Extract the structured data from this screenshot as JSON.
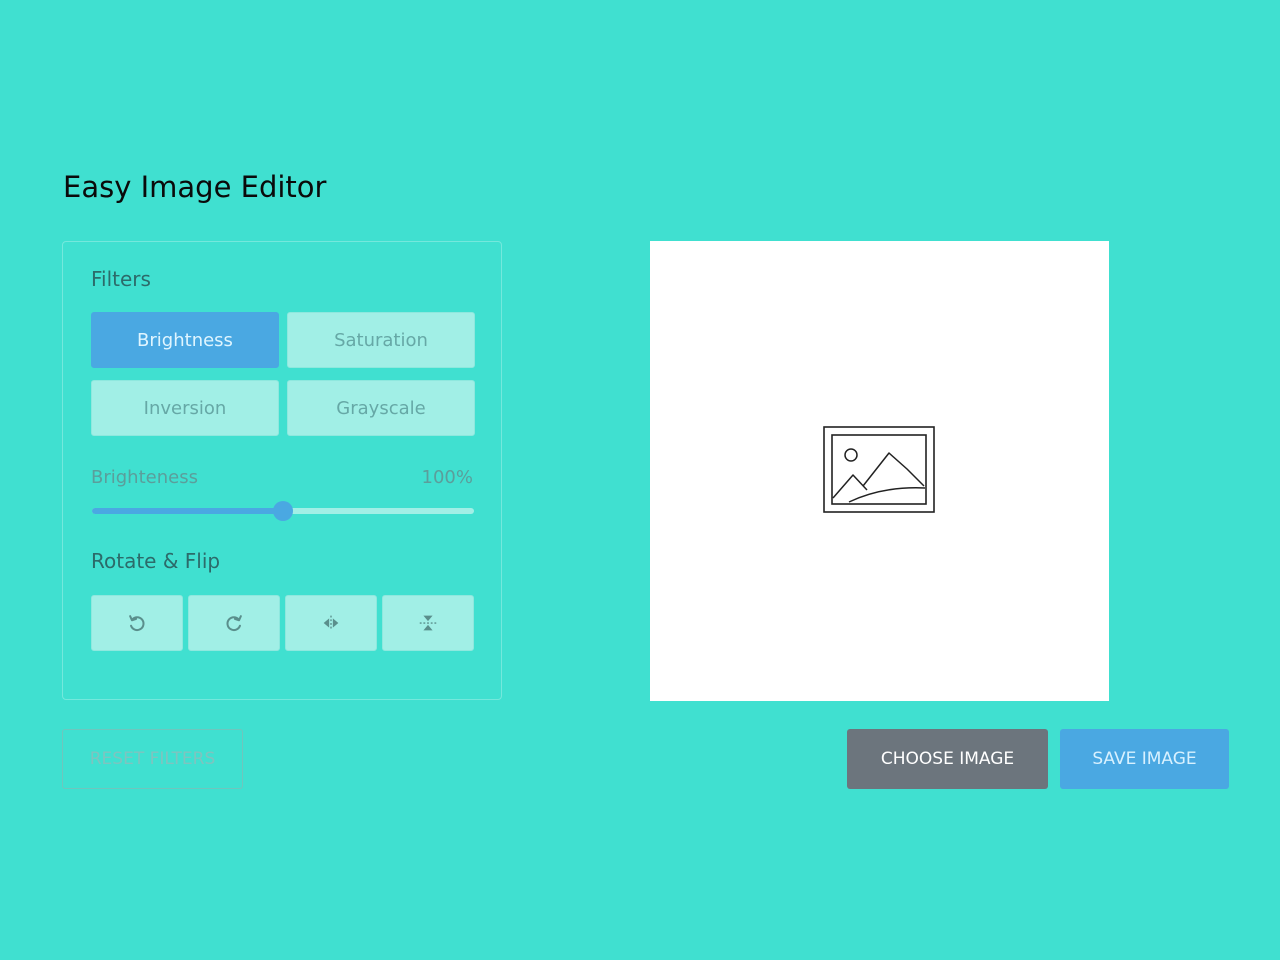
{
  "app": {
    "title": "Easy Image Editor"
  },
  "filters": {
    "title": "Filters",
    "buttons": [
      {
        "label": "Brightness",
        "active": true
      },
      {
        "label": "Saturation",
        "active": false
      },
      {
        "label": "Inversion",
        "active": false
      },
      {
        "label": "Grayscale",
        "active": false
      }
    ],
    "slider": {
      "label": "Brighteness",
      "value_text": "100%",
      "fraction": 0.5
    }
  },
  "rotate": {
    "title": "Rotate & Flip",
    "buttons": [
      {
        "icon": "rotate-left-icon"
      },
      {
        "icon": "rotate-right-icon"
      },
      {
        "icon": "flip-horizontal-icon"
      },
      {
        "icon": "flip-vertical-icon"
      }
    ]
  },
  "preview": {
    "icon": "image-placeholder-icon"
  },
  "actions": {
    "reset_label": "RESET FILTERS",
    "choose_label": "CHOOSE IMAGE",
    "save_label": "SAVE IMAGE"
  },
  "colors": {
    "background": "#40e0d0",
    "accent": "#4aa8e2",
    "secondary": "#6c757d"
  }
}
